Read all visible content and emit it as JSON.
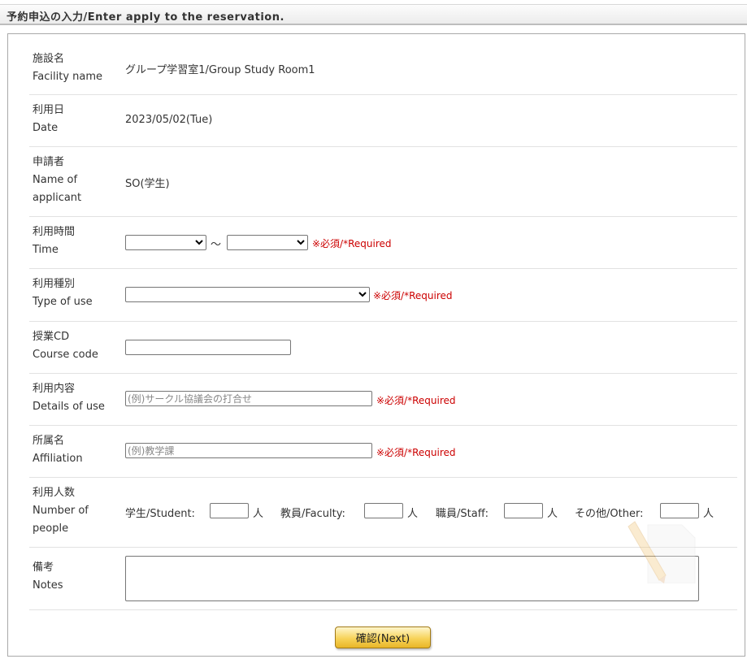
{
  "header": {
    "title": "予約申込の入力/Enter apply to the reservation."
  },
  "rows": {
    "facility": {
      "label_ja": "施設名",
      "label_en": "Facility name",
      "value": "グループ学習室1/Group Study Room1"
    },
    "date": {
      "label_ja": "利用日",
      "label_en": "Date",
      "value": "2023/05/02(Tue)"
    },
    "applicant": {
      "label_ja": "申請者",
      "label_en_1": "Name of",
      "label_en_2": "applicant",
      "value": "SO(学生)"
    },
    "time": {
      "label_ja": "利用時間",
      "label_en": "Time",
      "separator": "〜",
      "start_value": "",
      "end_value": "",
      "required": "※必須/*Required"
    },
    "type_of_use": {
      "label_ja": "利用種別",
      "label_en": "Type of use",
      "value": "",
      "required": "※必須/*Required"
    },
    "course_code": {
      "label_ja": "授業CD",
      "label_en": "Course code",
      "value": ""
    },
    "details": {
      "label_ja": "利用内容",
      "label_en": "Details of use",
      "placeholder": "(例)サークル協議会の打合せ",
      "required": "※必須/*Required"
    },
    "affiliation": {
      "label_ja": "所属名",
      "label_en": "Affiliation",
      "placeholder": "(例)教学課",
      "required": "※必須/*Required"
    },
    "people": {
      "label_ja": "利用人数",
      "label_en_1": "Number of",
      "label_en_2": "people",
      "student": "学生/Student:",
      "faculty": "教員/Faculty:",
      "staff": "職員/Staff:",
      "other": "その他/Other:",
      "unit": "人"
    },
    "notes": {
      "label_ja": "備考",
      "label_en": "Notes"
    }
  },
  "buttons": {
    "next": "確認(Next)"
  },
  "colors": {
    "required": "#cc0000",
    "button": "#f7d35a"
  }
}
